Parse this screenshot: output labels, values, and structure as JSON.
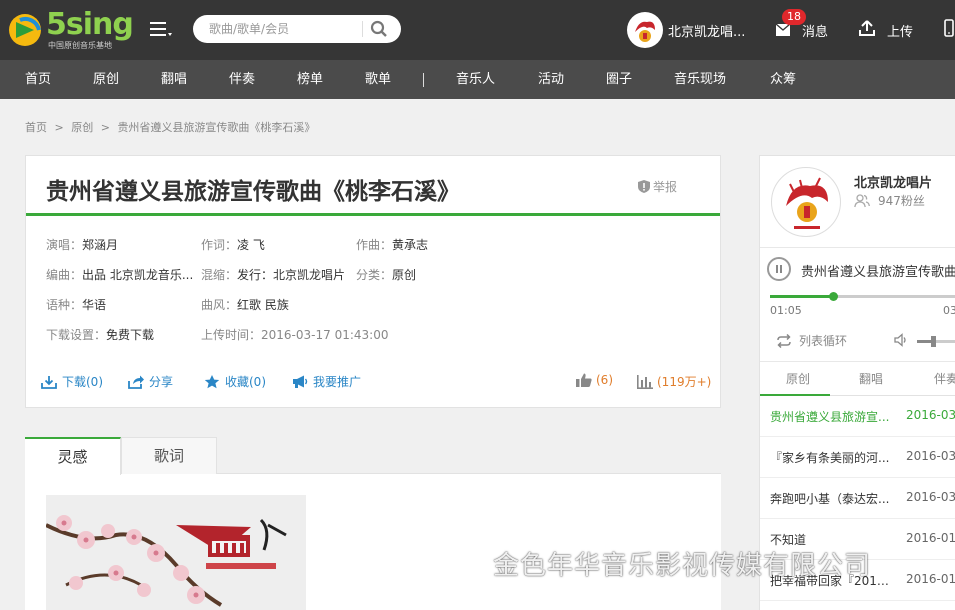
{
  "header": {
    "logo_text": "5sing",
    "logo_sub": "中国原创音乐基地",
    "search_placeholder": "歌曲/歌单/会员",
    "user_name": "北京凯龙唱...",
    "message_count": "18",
    "message_label": "消息",
    "upload_label": "上传"
  },
  "nav": {
    "items": [
      "首页",
      "原创",
      "翻唱",
      "伴奏",
      "榜单",
      "歌单",
      "音乐人",
      "活动",
      "圈子",
      "音乐现场",
      "众筹"
    ]
  },
  "breadcrumb": {
    "items": [
      "首页",
      ">",
      "原创",
      ">",
      "贵州省遵义县旅游宣传歌曲《桃李石溪》"
    ]
  },
  "song": {
    "title": "贵州省遵义县旅游宣传歌曲《桃李石溪》",
    "report_label": "举报",
    "meta": {
      "singer_label": "演唱：",
      "singer": "郑涵月",
      "lyricist_label": "作词：",
      "lyricist": "凌 飞",
      "composer_label": "作曲：",
      "composer": "黄承志",
      "arranger_label": "编曲：",
      "arranger": "出品 北京凯龙音乐...",
      "mix_label": "混缩：",
      "mix": "发行：北京凯龙唱片",
      "category_label": "分类：",
      "category": "原创",
      "language_label": "语种：",
      "language": "华语",
      "style_label": "曲风：",
      "style": "红歌 民族",
      "download_label": "下载设置：",
      "download": "免费下载",
      "upload_time_label": "上传时间：",
      "upload_time": "2016-03-17 01:43:00"
    },
    "actions": {
      "download": "下载(0)",
      "share": "分享",
      "favorite": "收藏(0)",
      "promote": "我要推广"
    },
    "stats": {
      "likes": "(6)",
      "plays": "(119万+)"
    }
  },
  "content_tabs": {
    "inspiration": "灵感",
    "lyrics": "歌词"
  },
  "sidebar": {
    "owner_name": "北京凯龙唱片",
    "fans": "947粉丝",
    "now_playing": "贵州省遵义县旅游宣传歌曲",
    "time_current": "01:05",
    "time_total": "03",
    "progress_fraction": 0.33,
    "volume_fraction": 0.35,
    "loop_label": "列表循环",
    "tabs": [
      "原创",
      "翻唱",
      "伴奏"
    ],
    "list": [
      {
        "title": "贵州省遵义县旅游宣...",
        "date": "2016-03-"
      },
      {
        "title": "『家乡有条美丽的河...",
        "date": "2016-03-"
      },
      {
        "title": "奔跑吧小基（泰达宏...",
        "date": "2016-03-"
      },
      {
        "title": "不知道",
        "date": "2016-01-"
      },
      {
        "title": "把幸福带回家『2016...",
        "date": "2016-01-"
      }
    ]
  },
  "watermark": {
    "text": "金色年华音乐影视传媒有限公司"
  },
  "colors": {
    "header_bg": "#363636",
    "nav_bg": "#4b4b4b",
    "accent_green": "#3aa93a",
    "link_blue": "#2a86c6",
    "stat_orange": "#e07d2b",
    "badge_red": "#e0282c"
  }
}
